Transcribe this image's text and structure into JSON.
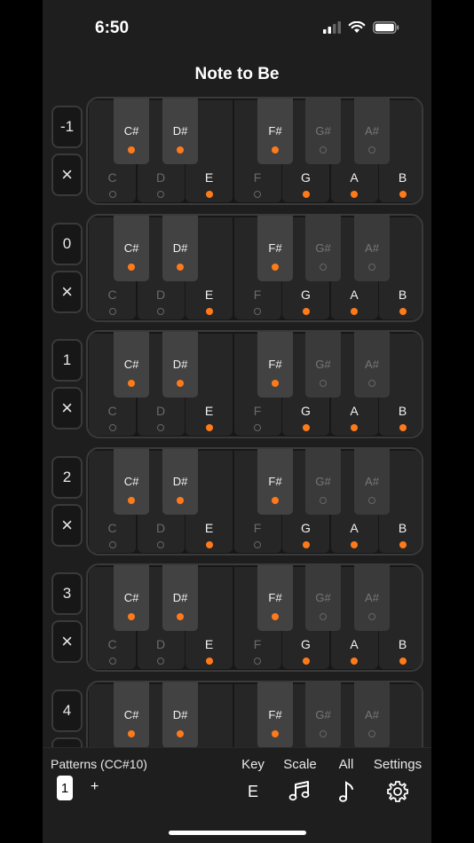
{
  "status": {
    "time": "6:50"
  },
  "app": {
    "title": "Note to Be"
  },
  "clear_symbol": "×",
  "octaves": [
    {
      "label": "-1"
    },
    {
      "label": "0"
    },
    {
      "label": "1"
    },
    {
      "label": "2"
    },
    {
      "label": "3"
    },
    {
      "label": "4"
    }
  ],
  "white_keys": [
    {
      "name": "C",
      "enabled": false
    },
    {
      "name": "D",
      "enabled": false
    },
    {
      "name": "E",
      "enabled": true
    },
    {
      "name": "F",
      "enabled": false
    },
    {
      "name": "G",
      "enabled": true
    },
    {
      "name": "A",
      "enabled": true
    },
    {
      "name": "B",
      "enabled": true
    }
  ],
  "black_keys": [
    {
      "name": "C#",
      "enabled": true
    },
    {
      "name": "D#",
      "enabled": true
    },
    {
      "name": "F#",
      "enabled": true
    },
    {
      "name": "G#",
      "enabled": false
    },
    {
      "name": "A#",
      "enabled": false
    }
  ],
  "colors": {
    "accent": "#ff7a1a",
    "background": "#1e1e1e"
  },
  "bottom": {
    "patterns_label": "Patterns (CC#10)",
    "pattern_selected": "1",
    "pattern_add": "+",
    "key_label": "Key",
    "key_value": "E",
    "scale_label": "Scale",
    "scale_icon": "music-notes-icon",
    "all_label": "All",
    "all_icon": "music-note-icon",
    "settings_label": "Settings",
    "settings_icon": "gear-icon"
  }
}
